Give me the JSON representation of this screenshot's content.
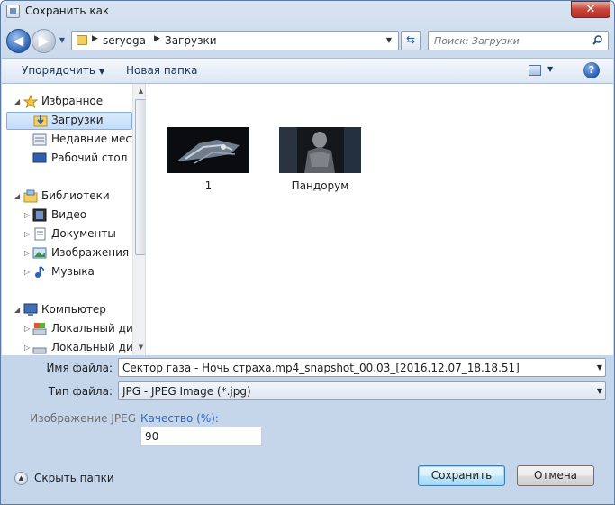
{
  "window": {
    "title": "Сохранить как",
    "close_label": "✕"
  },
  "nav": {
    "back_label": "◀",
    "forward_label": "▶",
    "breadcrumbs": [
      "seryoga",
      "Загрузки"
    ],
    "search_placeholder": "Поиск: Загрузки"
  },
  "toolbar": {
    "organize_label": "Упорядочить",
    "new_folder_label": "Новая папка",
    "help_label": "?"
  },
  "tree": {
    "favorites_label": "Избранное",
    "downloads_label": "Загрузки",
    "recent_label": "Недавние места",
    "desktop_label": "Рабочий стол",
    "libraries_label": "Библиотеки",
    "video_label": "Видео",
    "documents_label": "Документы",
    "images_label": "Изображения",
    "music_label": "Музыка",
    "computer_label": "Компьютер",
    "local_disk_label": "Локальный диск",
    "local_disk2_label": "Локальный диск"
  },
  "files": [
    {
      "name": "1"
    },
    {
      "name": "Пандорум"
    }
  ],
  "form": {
    "filename_label": "Имя файла:",
    "filename_value": "Сектор газа - Ночь страха.mp4_snapshot_00.03_[2016.12.07_18.18.51]",
    "filetype_label": "Тип файла:",
    "filetype_value": "JPG - JPEG Image (*.jpg)",
    "jpeg_label": "Изображение JPEG",
    "quality_label": "Качество (%):",
    "quality_value": "90"
  },
  "footer": {
    "hide_folders_label": "Скрыть папки",
    "save_label": "Сохранить",
    "cancel_label": "Отмена"
  },
  "colors": {
    "accent": "#2f67c0",
    "selection": "#c1dcfb",
    "titlebar": "#c6d6ea",
    "close": "#c6453a"
  }
}
